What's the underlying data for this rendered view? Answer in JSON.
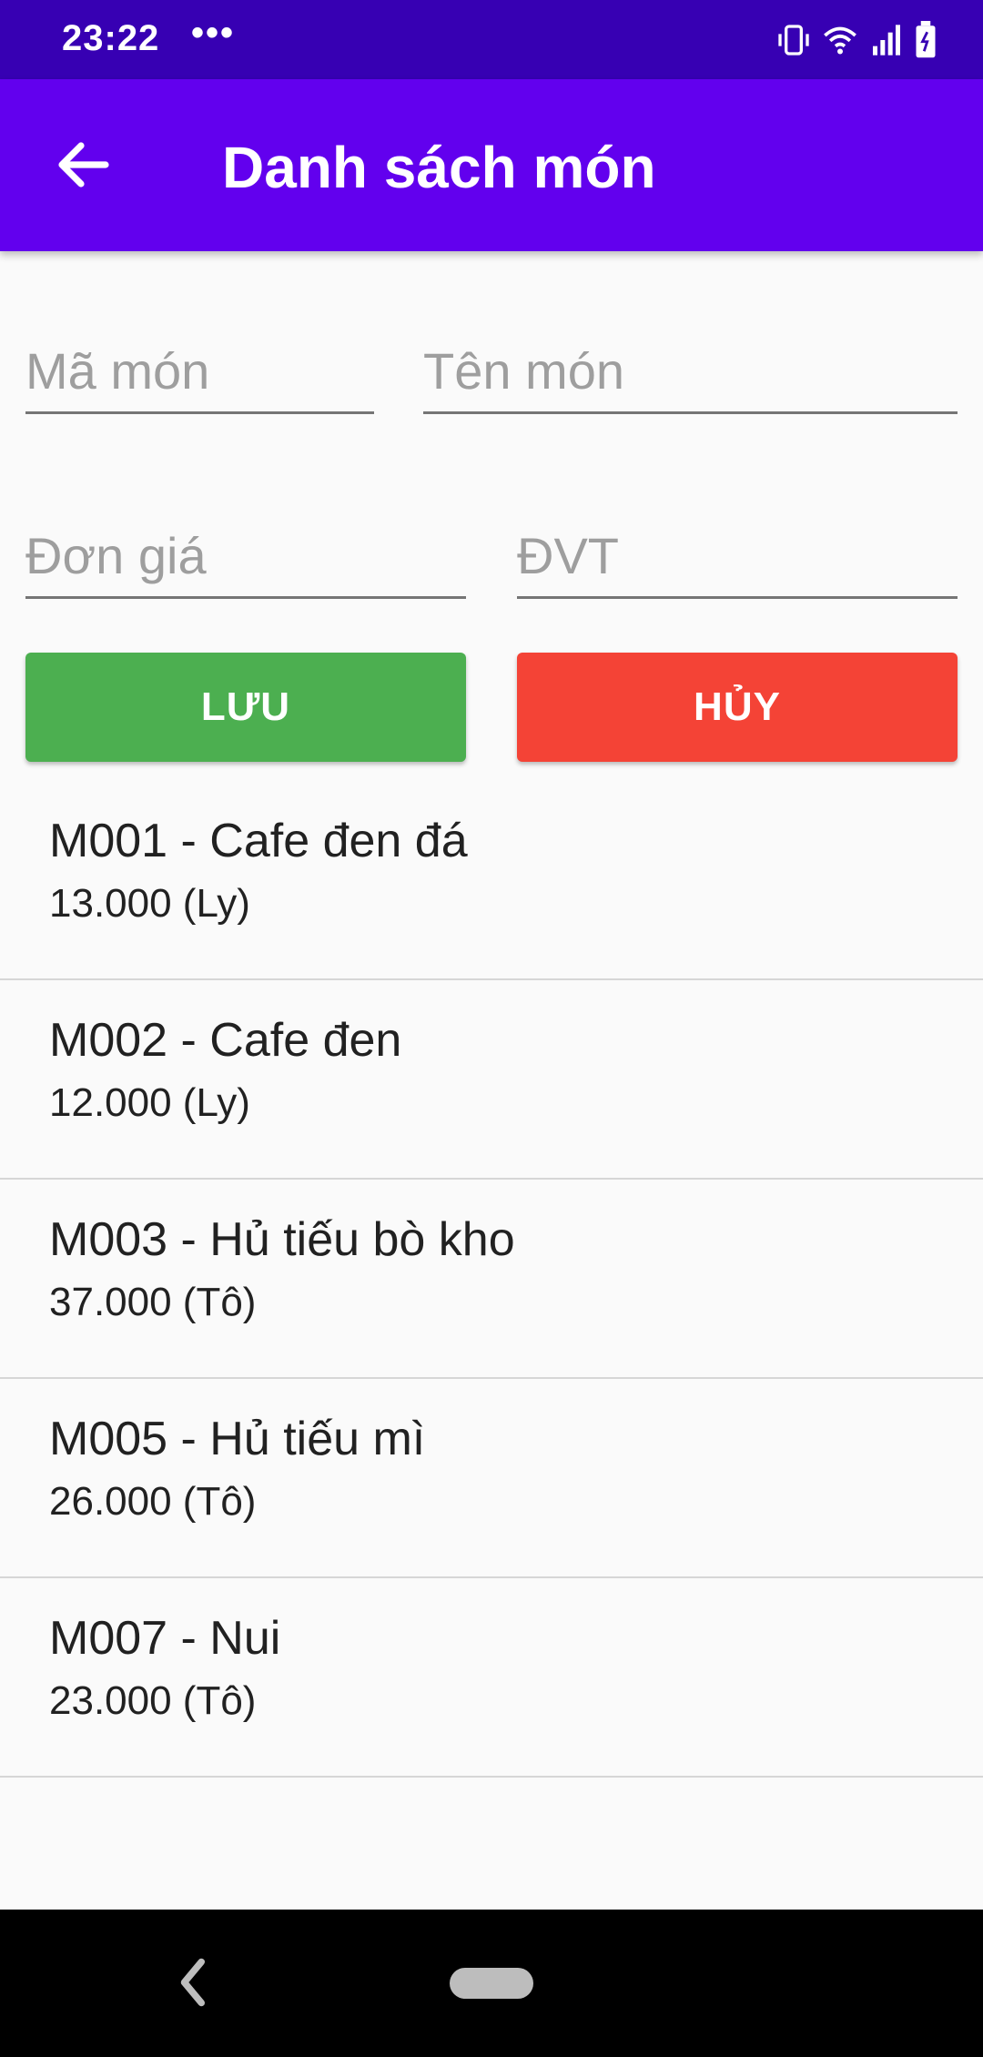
{
  "status_bar": {
    "time": "23:22",
    "dots": "•••"
  },
  "app_bar": {
    "title": "Danh sách món"
  },
  "form": {
    "code_placeholder": "Mã món",
    "name_placeholder": "Tên món",
    "price_placeholder": "Đơn giá",
    "unit_placeholder": "ĐVT",
    "save_label": "LƯU",
    "cancel_label": "HỦY"
  },
  "items": [
    {
      "title": "M001 - Cafe đen đá",
      "sub": "13.000 (Ly)"
    },
    {
      "title": "M002 - Cafe đen",
      "sub": "12.000 (Ly)"
    },
    {
      "title": "M003 - Hủ tiếu bò kho",
      "sub": "37.000 (Tô)"
    },
    {
      "title": "M005 - Hủ tiếu mì",
      "sub": "26.000 (Tô)"
    },
    {
      "title": "M007 - Nui",
      "sub": "23.000 (Tô)"
    }
  ],
  "colors": {
    "status_bar": "#3700b3",
    "app_bar": "#6200ee",
    "save": "#4caf50",
    "cancel": "#f44336"
  }
}
